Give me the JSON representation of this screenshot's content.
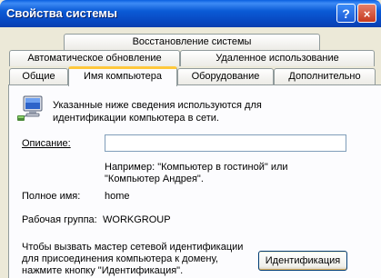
{
  "window": {
    "title": "Свойства системы",
    "help_icon": "?",
    "close_icon": "×"
  },
  "tabs": {
    "row1": [
      "Восстановление системы"
    ],
    "row2": [
      "Автоматическое обновление",
      "Удаленное использование"
    ],
    "row3": [
      "Общие",
      "Имя компьютера",
      "Оборудование",
      "Дополнительно"
    ],
    "active": "Имя компьютера"
  },
  "content": {
    "info_text_line1": "Указанные ниже сведения используются для",
    "info_text_line2": "идентификации компьютера в сети.",
    "description_label": "Описание:",
    "description_value": "",
    "example_line1": "Например: \"Компьютер в гостиной\" или",
    "example_line2": "\"Компьютер Андрея\".",
    "full_name_label": "Полное имя:",
    "full_name_value": "home",
    "workgroup_label": "Рабочая группа:",
    "workgroup_value": "WORKGROUP",
    "wizard_line1": "Чтобы вызвать мастер сетевой идентификации",
    "wizard_line2": "для присоединения компьютера к домену,",
    "wizard_line3": "нажмите кнопку \"Идентификация\".",
    "identify_button": "Идентификация"
  },
  "icons": {
    "computer": "computer-network-icon"
  }
}
